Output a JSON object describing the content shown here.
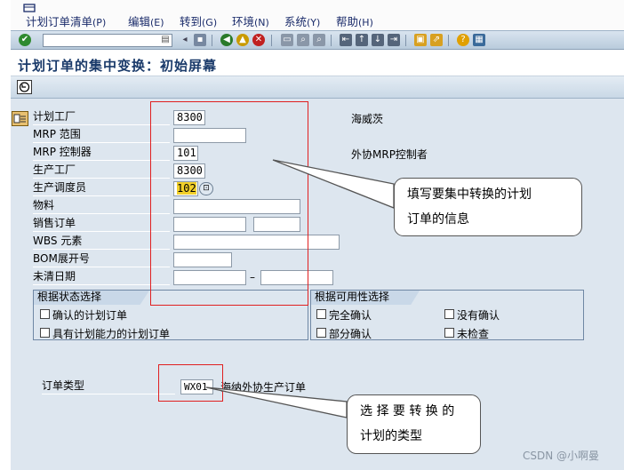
{
  "menu": [
    {
      "label": "计划订单清单",
      "accel": "(P)"
    },
    {
      "label": "编辑",
      "accel": "(E)"
    },
    {
      "label": "转到",
      "accel": "(G)"
    },
    {
      "label": "环境",
      "accel": "(N)"
    },
    {
      "label": "系统",
      "accel": "(Y)"
    },
    {
      "label": "帮助",
      "accel": "(H)"
    }
  ],
  "page_title": "计划订单的集中变换：初始屏幕",
  "form": {
    "plant_label": "计划工厂",
    "plant_value": "8300",
    "plant_desc": "海威茨",
    "mrp_area_label": "MRP 范围",
    "mrp_controller_label": "MRP 控制器",
    "mrp_controller_value": "101",
    "mrp_controller_desc": "外协MRP控制者",
    "prod_plant_label": "生产工厂",
    "prod_plant_value": "8300",
    "scheduler_label": "生产调度员",
    "scheduler_value": "102",
    "material_label": "物料",
    "sales_order_label": "销售订单",
    "wbs_label": "WBS 元素",
    "bom_label": "BOM展开号",
    "open_date_label": "未清日期",
    "date_dash": "–"
  },
  "status_group": {
    "title": "根据状态选择",
    "items": [
      "确认的计划订单",
      "具有计划能力的计划订单"
    ]
  },
  "avail_group": {
    "title": "根据可用性选择",
    "items": [
      "完全确认",
      "部分确认",
      "没有确认",
      "未检查"
    ]
  },
  "order_type": {
    "label": "订单类型",
    "value": "WX01",
    "desc": "海纳外协生产订单"
  },
  "callouts": {
    "c1_line1": "填写要集中转换的计划",
    "c1_line2": "订单的信息",
    "c2_line1": "选 择 要 转 换 的",
    "c2_line2": "计划的类型"
  },
  "watermark": "CSDN @小啊曼",
  "colors": {
    "accent": "#e02020",
    "title": "#1a3a6a",
    "panel": "#dde6ef"
  }
}
